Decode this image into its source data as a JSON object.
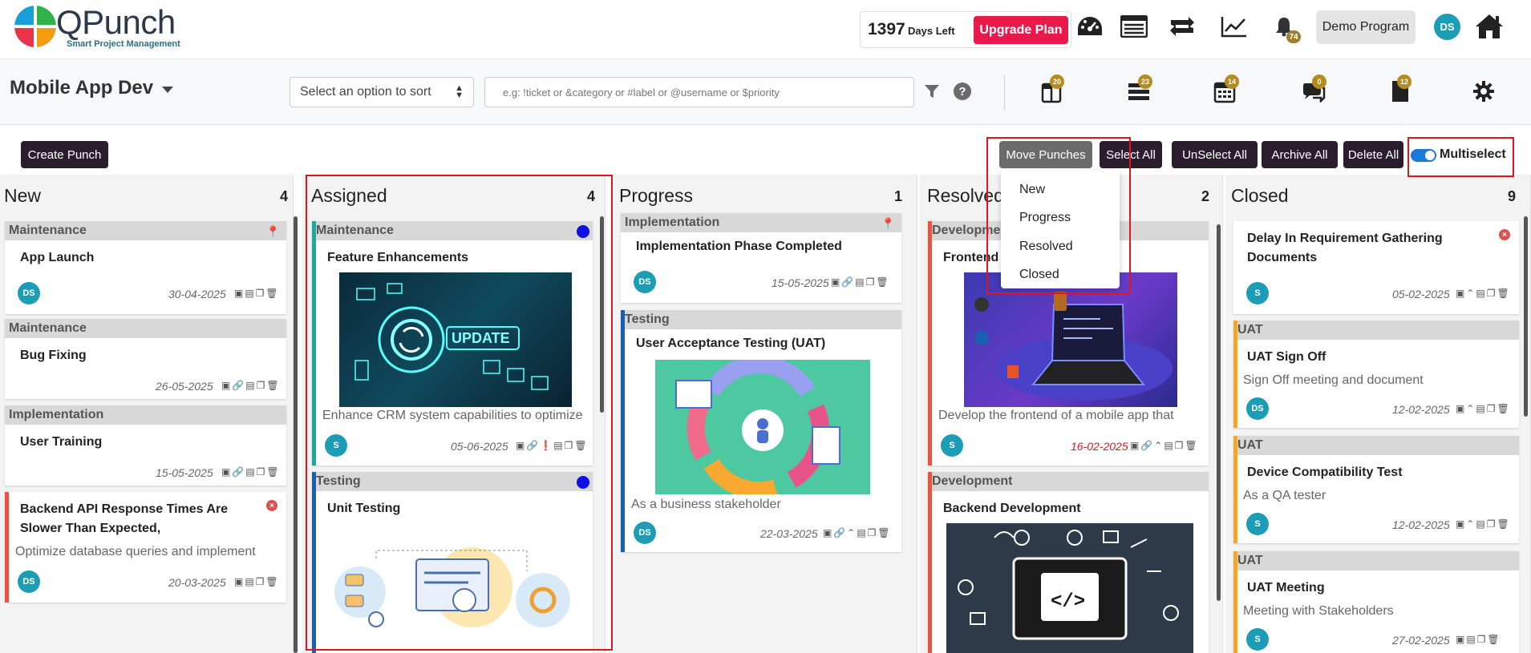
{
  "header": {
    "brand": "QPunch",
    "tagline": "Smart Project Management",
    "days_left_number": "1397",
    "days_left_text": "Days Left",
    "upgrade_label": "Upgrade Plan",
    "notification_count": "74",
    "program_label": "Demo Program",
    "avatar_initials": "DS"
  },
  "subheader": {
    "project_name": "Mobile App Dev",
    "sort_placeholder": "Select an option to sort",
    "search_placeholder": "e.g: !ticket or &category or #label or @username or $priority",
    "tool_badges": [
      "20",
      "23",
      "14",
      "0",
      "12"
    ]
  },
  "actions": {
    "create": "Create Punch",
    "move": "Move Punches",
    "select_all": "Select All",
    "unselect_all": "UnSelect All",
    "archive_all": "Archive All",
    "delete_all": "Delete All",
    "multiselect": "Multiselect",
    "multiselect_on": true
  },
  "move_menu": [
    "New",
    "Progress",
    "Resolved",
    "Closed"
  ],
  "columns": [
    {
      "title": "New",
      "count": "4",
      "cards": [
        {
          "category": "Maintenance",
          "title": "App Launch",
          "avatar": "DS",
          "date": "30-04-2025"
        },
        {
          "category": "Maintenance",
          "title": "Bug Fixing",
          "date": "26-05-2025"
        },
        {
          "category": "Implementation",
          "title": "User Training",
          "date": "15-05-2025"
        },
        {
          "title_line1": "Backend API Response Times Are",
          "title_line2": "Slower Than Expected,",
          "desc": "Optimize database queries and implement",
          "avatar": "DS",
          "date": "20-03-2025"
        }
      ]
    },
    {
      "title": "Assigned",
      "count": "4",
      "cards": [
        {
          "category": "Maintenance",
          "title": "Feature Enhancements",
          "desc": "Enhance CRM system capabilities to optimize",
          "avatar": "S",
          "date": "05-06-2025",
          "image_text": "UPDATE"
        },
        {
          "category": "Testing",
          "title": "Unit Testing"
        }
      ]
    },
    {
      "title": "Progress",
      "count": "1",
      "cards": [
        {
          "category": "Implementation",
          "title": "Implementation Phase Completed",
          "avatar": "DS",
          "date": "15-05-2025"
        },
        {
          "category": "Testing",
          "title": "User Acceptance Testing (UAT)",
          "desc": "As a business stakeholder",
          "avatar": "DS",
          "date": "22-03-2025"
        }
      ]
    },
    {
      "title": "Resolved",
      "count": "2",
      "cards": [
        {
          "category": "Development",
          "title": "Frontend Development",
          "desc": "Develop the frontend of a mobile app that",
          "avatar": "S",
          "date": "16-02-2025"
        },
        {
          "category": "Development",
          "title": "Backend Development"
        }
      ]
    },
    {
      "title": "Closed",
      "count": "9",
      "cards": [
        {
          "title_line1": "Delay In Requirement Gathering",
          "title_line2": "Documents",
          "avatar": "S",
          "date": "05-02-2025"
        },
        {
          "category": "UAT",
          "title": "UAT Sign Off",
          "desc": "Sign Off meeting and document",
          "avatar": "DS",
          "date": "12-02-2025"
        },
        {
          "category": "UAT",
          "title": "Device Compatibility Test",
          "desc": "As a QA tester",
          "avatar": "S",
          "date": "12-02-2025"
        },
        {
          "category": "UAT",
          "title": "UAT Meeting",
          "desc": "Meeting with Stakeholders",
          "avatar": "S",
          "date": "27-02-2025"
        }
      ]
    }
  ],
  "colors": {
    "accent_red": "#e8194b",
    "dark_button": "#2b1d2e",
    "avatar": "#1c9cb5",
    "highlight_box": "#e0161e",
    "teal_bar": "#1fa89a",
    "blue_bar": "#1a5fb4",
    "red_bar": "#f0503c",
    "orange_bar": "#f5a623"
  }
}
